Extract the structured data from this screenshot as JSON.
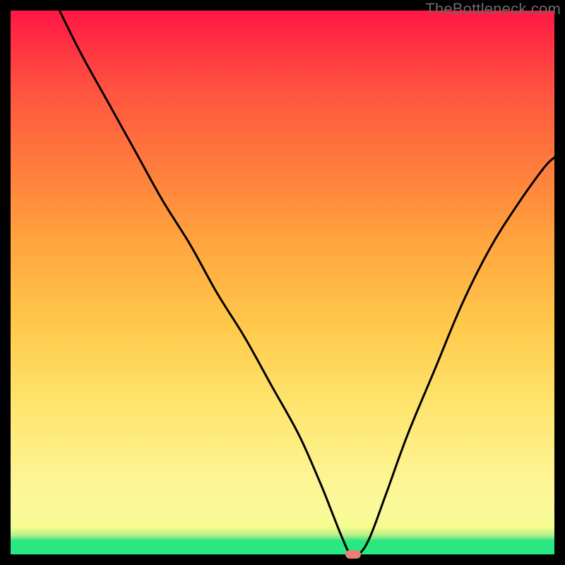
{
  "watermark": "TheBottleneck.com",
  "colors": {
    "background": "#000000",
    "curve": "#000000",
    "marker": "#e88074"
  },
  "chart_data": {
    "type": "line",
    "title": "",
    "xlabel": "",
    "ylabel": "",
    "xlim": [
      0,
      100
    ],
    "ylim": [
      0,
      100
    ],
    "grid": false,
    "legend": false,
    "series": [
      {
        "name": "bottleneck-curve",
        "x": [
          9,
          13,
          18,
          23,
          28,
          33,
          38,
          43,
          48,
          53,
          57,
          59,
          61,
          62.5,
          64,
          66,
          69,
          73,
          78,
          83,
          88,
          93,
          98,
          100
        ],
        "y": [
          100,
          92,
          83,
          74,
          65,
          57,
          48,
          40,
          31,
          22,
          13,
          8,
          3,
          0,
          0,
          3,
          11,
          22,
          34,
          46,
          56,
          64,
          71,
          73
        ]
      }
    ],
    "marker": {
      "x": 63,
      "y": 0
    },
    "gradient_stops": [
      {
        "pos": 0,
        "color": "#29e881"
      },
      {
        "pos": 3,
        "color": "#b4f089"
      },
      {
        "pos": 6,
        "color": "#f9f98f"
      },
      {
        "pos": 20,
        "color": "#fee46c"
      },
      {
        "pos": 40,
        "color": "#ffc94b"
      },
      {
        "pos": 60,
        "color": "#ffa03e"
      },
      {
        "pos": 80,
        "color": "#ff6a3e"
      },
      {
        "pos": 100,
        "color": "#ff1744"
      }
    ]
  }
}
